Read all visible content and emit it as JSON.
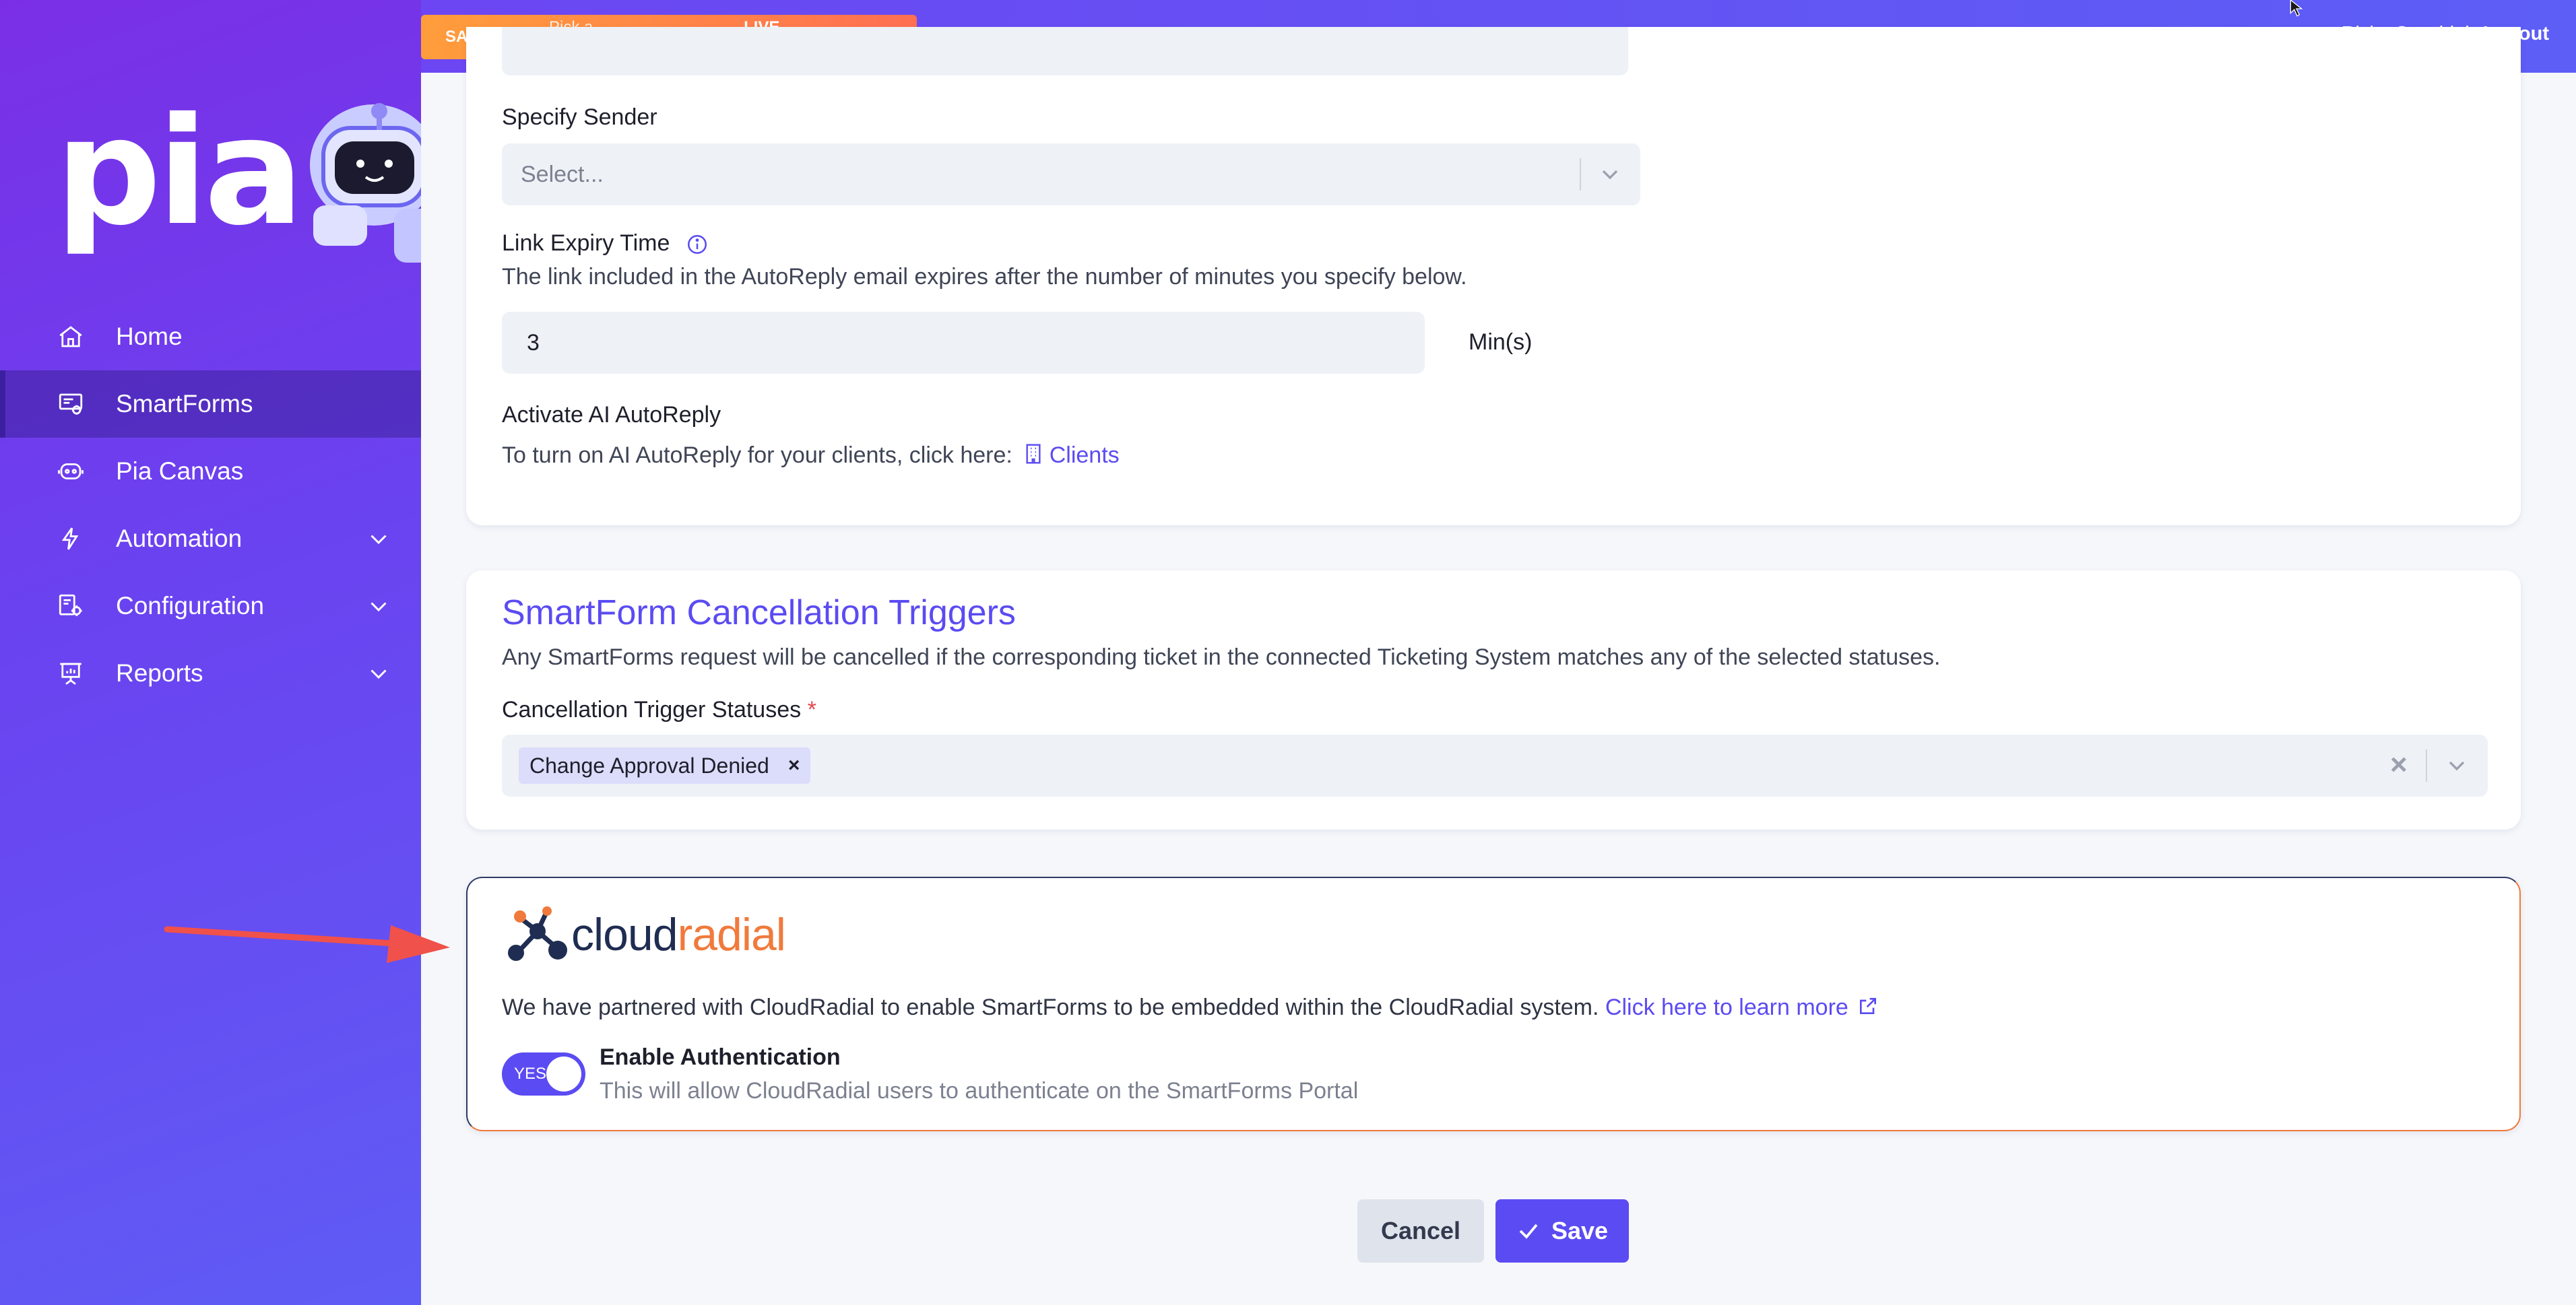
{
  "topbar": {
    "sandbox_label": "SANDBOX:",
    "sandbox_placeholder": "Pick a Sandbox",
    "sandbox_separator": "|",
    "live_mode": "LIVE MODE",
    "user_name": "Ricky Cecchini",
    "logout": "Logout"
  },
  "sidebar": {
    "logo": "pia",
    "items": [
      {
        "label": "Home",
        "icon": "home-icon"
      },
      {
        "label": "SmartForms",
        "icon": "smartforms-icon",
        "active": true
      },
      {
        "label": "Pia Canvas",
        "icon": "canvas-icon"
      },
      {
        "label": "Automation",
        "icon": "lightning-icon",
        "expandable": true
      },
      {
        "label": "Configuration",
        "icon": "config-icon",
        "expandable": true
      },
      {
        "label": "Reports",
        "icon": "reports-icon",
        "expandable": true
      }
    ]
  },
  "autoreply": {
    "sender_label": "Specify Sender",
    "sender_placeholder": "Select...",
    "expiry_label": "Link Expiry Time",
    "expiry_hint": "The link included in the AutoReply email expires after the number of minutes you specify below.",
    "expiry_value": "3",
    "expiry_unit": "Min(s)",
    "activate_label": "Activate AI AutoReply",
    "activate_hint": "To turn on AI AutoReply for your clients, click here:",
    "clients_link": "Clients"
  },
  "cancellation": {
    "title": "SmartForm Cancellation Triggers",
    "description": "Any SmartForms request will be cancelled if the corresponding ticket in the connected Ticketing System matches any of the selected statuses.",
    "statuses_label": "Cancellation Trigger Statuses",
    "required_mark": "*",
    "selected": [
      "Change Approval Denied"
    ],
    "remove_mark": "×",
    "clear_mark": "×"
  },
  "cloudradial": {
    "logo_cloud": "cloud",
    "logo_radial": "radial",
    "partner_text": "We have partnered with CloudRadial to enable SmartForms to be embedded within the CloudRadial system.",
    "learn_more": "Click here to learn more",
    "toggle_text": "YES",
    "toggle_on": true,
    "auth_label": "Enable Authentication",
    "auth_hint": "This will allow CloudRadial users to authenticate on the SmartForms Portal"
  },
  "actions": {
    "cancel": "Cancel",
    "save": "Save"
  },
  "colors": {
    "accent": "#5b4bf2",
    "sandbox_orange": "#ff8a45",
    "cloudradial_orange": "#f07a3c",
    "cloudradial_navy": "#1f2d52",
    "annotation_arrow": "#f0514a"
  }
}
